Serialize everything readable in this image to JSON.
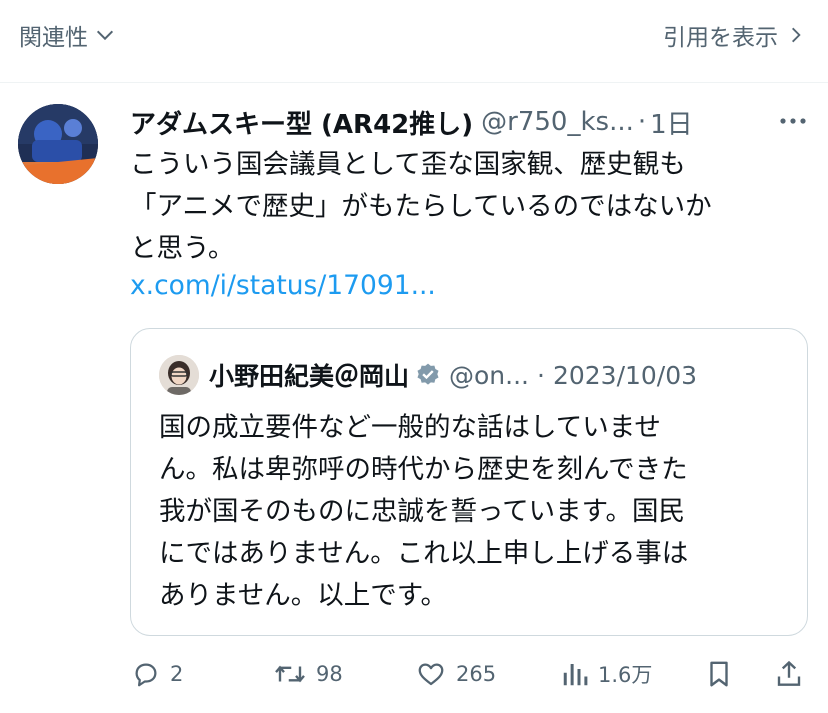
{
  "topbar": {
    "sort_label": "関連性",
    "quote_link_label": "引用を表示"
  },
  "post": {
    "author_name": "アダムスキー型 (AR42推し)",
    "handle": "@r750_ks...",
    "separator": "·",
    "time": "1日",
    "body_lines": [
      "こういう国会議員として歪な国家観、歴史観も",
      "「アニメで歴史」がもたらしているのではないか",
      "と思う。"
    ],
    "link": "x.com/i/status/17091..."
  },
  "quote": {
    "author_name": "小野田紀美＠岡山",
    "handle": "@on...",
    "separator": "·",
    "date": "2023/10/03",
    "body_lines": [
      "国の成立要件など一般的な話はしていませ",
      "ん。私は卑弥呼の時代から歴史を刻んできた",
      "我が国そのものに忠誠を誓っています。国民",
      "にではありません。これ以上申し上げる事は",
      "ありません。以上です。"
    ]
  },
  "actions": {
    "replies": "2",
    "reposts": "98",
    "likes": "265",
    "views": "1.6万"
  },
  "colors": {
    "text": "#0f1419",
    "secondary": "#536471",
    "link": "#1d9bf0",
    "verified": "#829aab",
    "border": "#cfd9de"
  },
  "icons": [
    "chevron-down-icon",
    "chevron-right-icon",
    "more-icon",
    "verified-icon",
    "reply-icon",
    "repost-icon",
    "like-icon",
    "views-icon",
    "bookmark-icon",
    "share-icon"
  ]
}
